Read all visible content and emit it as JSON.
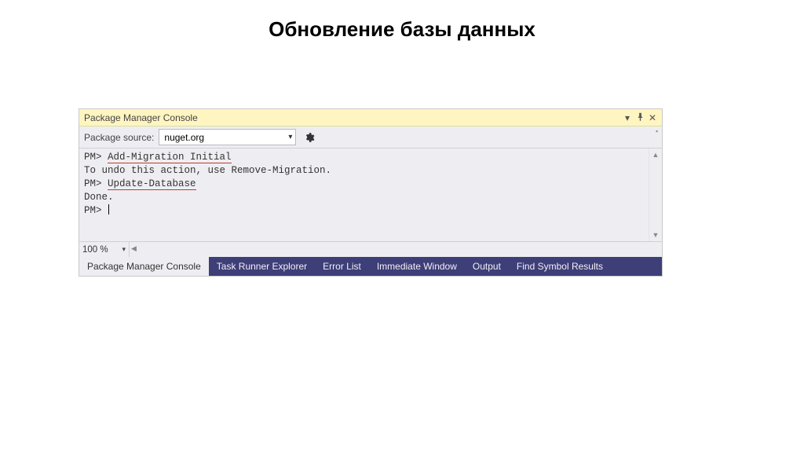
{
  "title": "Обновление базы данных",
  "panel": {
    "header": "Package Manager Console",
    "toolbar": {
      "source_label": "Package source:",
      "source_value": "nuget.org"
    },
    "console": {
      "prompt": "PM>",
      "line1_cmd": "Add-Migration Initial",
      "line2": "To undo this action, use Remove-Migration.",
      "line3_cmd": "Update-Database",
      "line4": "Done.",
      "line5_prompt": "PM>"
    },
    "zoom": "100 %",
    "tabs": [
      "Package Manager Console",
      "Task Runner Explorer",
      "Error List",
      "Immediate Window",
      "Output",
      "Find Symbol Results"
    ]
  }
}
